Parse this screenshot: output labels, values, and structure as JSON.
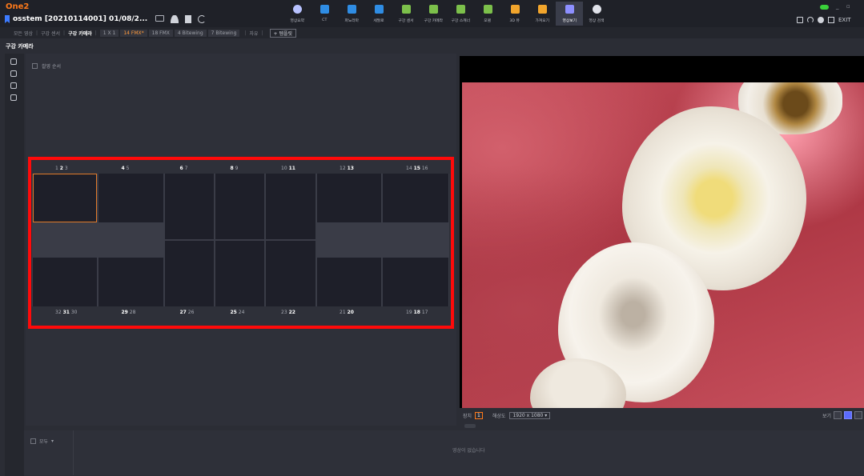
{
  "app": {
    "logo": "One2"
  },
  "patient": {
    "label": "osstem  [20210114001] 01/08/2..."
  },
  "nav": {
    "items": [
      {
        "label": "영상요약",
        "icon": "clock-icon",
        "color": "#b8c2ff"
      },
      {
        "label": "CT",
        "icon": "ct-icon",
        "color": "#2f8de4"
      },
      {
        "label": "파노라마",
        "icon": "panorama-icon",
        "color": "#2f8de4"
      },
      {
        "label": "세팔로",
        "icon": "cephalo-icon",
        "color": "#2f8de4"
      },
      {
        "label": "구강 센서",
        "icon": "sensor-icon",
        "color": "#7cc04b"
      },
      {
        "label": "구강 카메라",
        "icon": "camera-icon",
        "color": "#7cc04b"
      },
      {
        "label": "구강 스캐너",
        "icon": "scanner-icon",
        "color": "#7cc04b"
      },
      {
        "label": "모델",
        "icon": "model-icon",
        "color": "#7cc04b"
      },
      {
        "label": "3D 뷰",
        "icon": "3d-view-icon",
        "color": "#f2a52c"
      },
      {
        "label": "가져오기",
        "icon": "import-icon",
        "color": "#f2a52c"
      },
      {
        "label": "영상보기",
        "icon": "image-view-icon",
        "color": "#8d8fff",
        "active": true
      },
      {
        "label": "영상 검색",
        "icon": "search-icon",
        "color": "#e0e2ea"
      }
    ]
  },
  "top_right": {
    "minimize": "_",
    "maximize": "▫",
    "exit_label": "EXIT"
  },
  "subbar": {
    "crumbs": [
      "모든 영상",
      "구강 센서"
    ],
    "current": "구강 카메라",
    "layouts": [
      "1 X 1",
      "14 FMX*",
      "18 FMX",
      "4 Bitewing",
      "7 Bitewing"
    ],
    "active_layout": "14 FMX*",
    "free": "자유",
    "add_button": "+ 템플릿"
  },
  "section_title": "구강 카메라",
  "filter": {
    "label": "촬영 순서"
  },
  "fmx": {
    "top_labels": [
      {
        "a": "1",
        "b": "2",
        "c": "3",
        "bold": "b"
      },
      {
        "a": "4",
        "b": "5",
        "bold": "a"
      },
      {
        "a": "6",
        "b": "7",
        "bold": "a"
      },
      {
        "a": "8",
        "b": "9",
        "bold": "a"
      },
      {
        "a": "10",
        "b": "11",
        "bold": "b"
      },
      {
        "a": "12",
        "b": "13",
        "bold": "b"
      },
      {
        "a": "14",
        "b": "15",
        "c": "16",
        "bold": "b"
      }
    ],
    "bottom_labels": [
      {
        "a": "32",
        "b": "31",
        "c": "30",
        "bold": "b"
      },
      {
        "a": "29",
        "b": "28",
        "bold": "a"
      },
      {
        "a": "27",
        "b": "26",
        "bold": "a"
      },
      {
        "a": "25",
        "b": "24",
        "bold": "a"
      },
      {
        "a": "23",
        "b": "22",
        "bold": "b"
      },
      {
        "a": "21",
        "b": "20",
        "bold": "b"
      },
      {
        "a": "19",
        "b": "18",
        "c": "17",
        "bold": "b"
      }
    ]
  },
  "viewer_controls": {
    "channel_label": "장치",
    "channel_value": "1",
    "resolution_label": "해상도",
    "resolution_value": "1920 x 1080",
    "right_label": "보기"
  },
  "bottom": {
    "select_label": "모두",
    "message": "영상이 없습니다"
  }
}
